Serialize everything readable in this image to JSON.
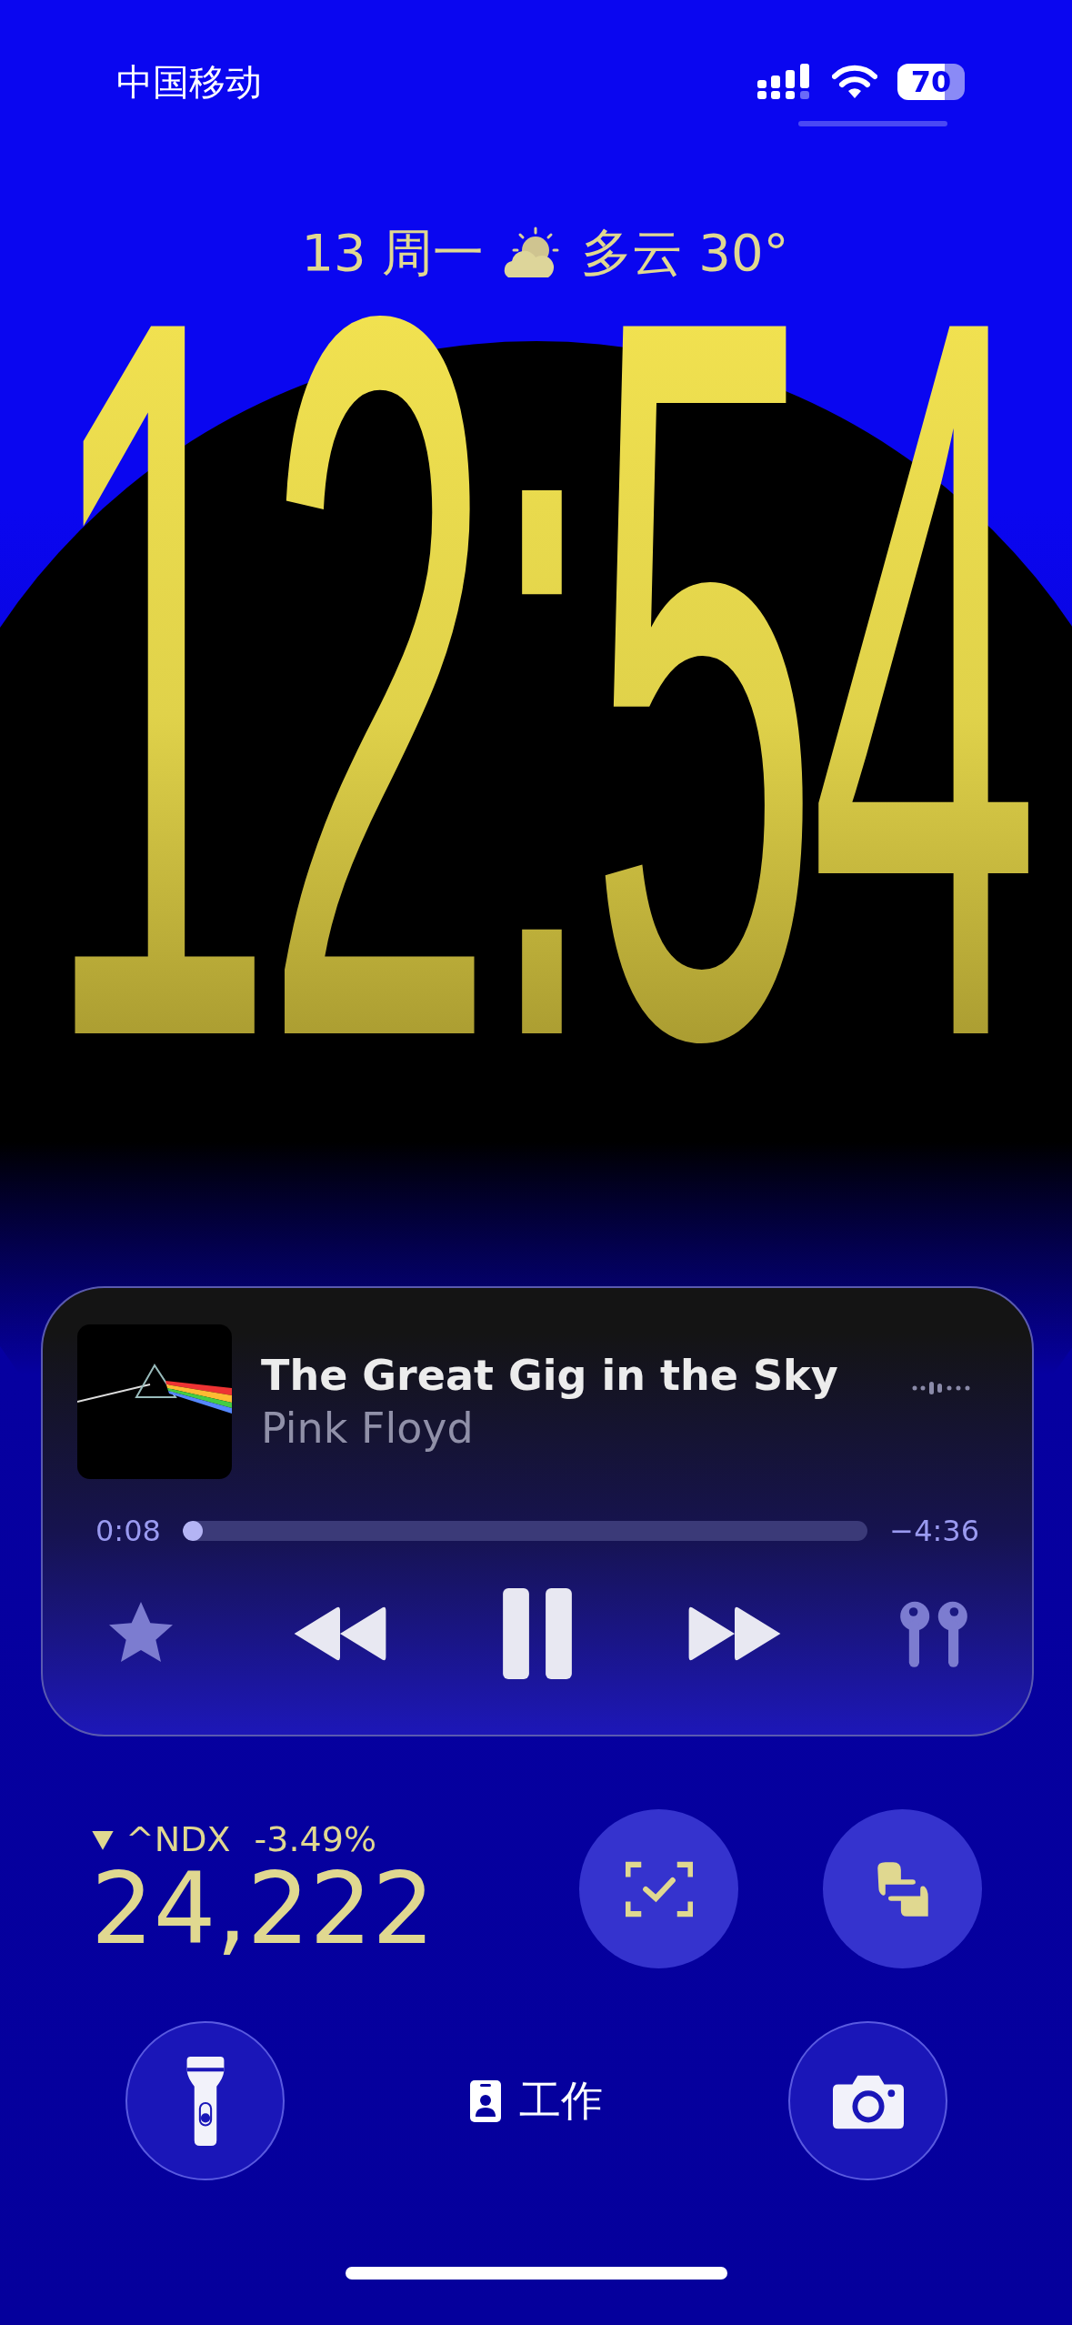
{
  "status_bar": {
    "carrier": "中国移动",
    "battery": "70"
  },
  "date_line": {
    "date": "13 周一",
    "weather": "多云 30°"
  },
  "clock": {
    "time": "12:54"
  },
  "now_playing": {
    "title": "The Great Gig in the Sky",
    "artist": "Pink Floyd",
    "elapsed": "0:08",
    "remaining": "−4:36",
    "level": 0.03,
    "playing": true
  },
  "stock": {
    "symbol": "^NDX",
    "change": "-3.49%",
    "falling": true,
    "price": "24,222"
  },
  "focus": {
    "label": "工作"
  }
}
